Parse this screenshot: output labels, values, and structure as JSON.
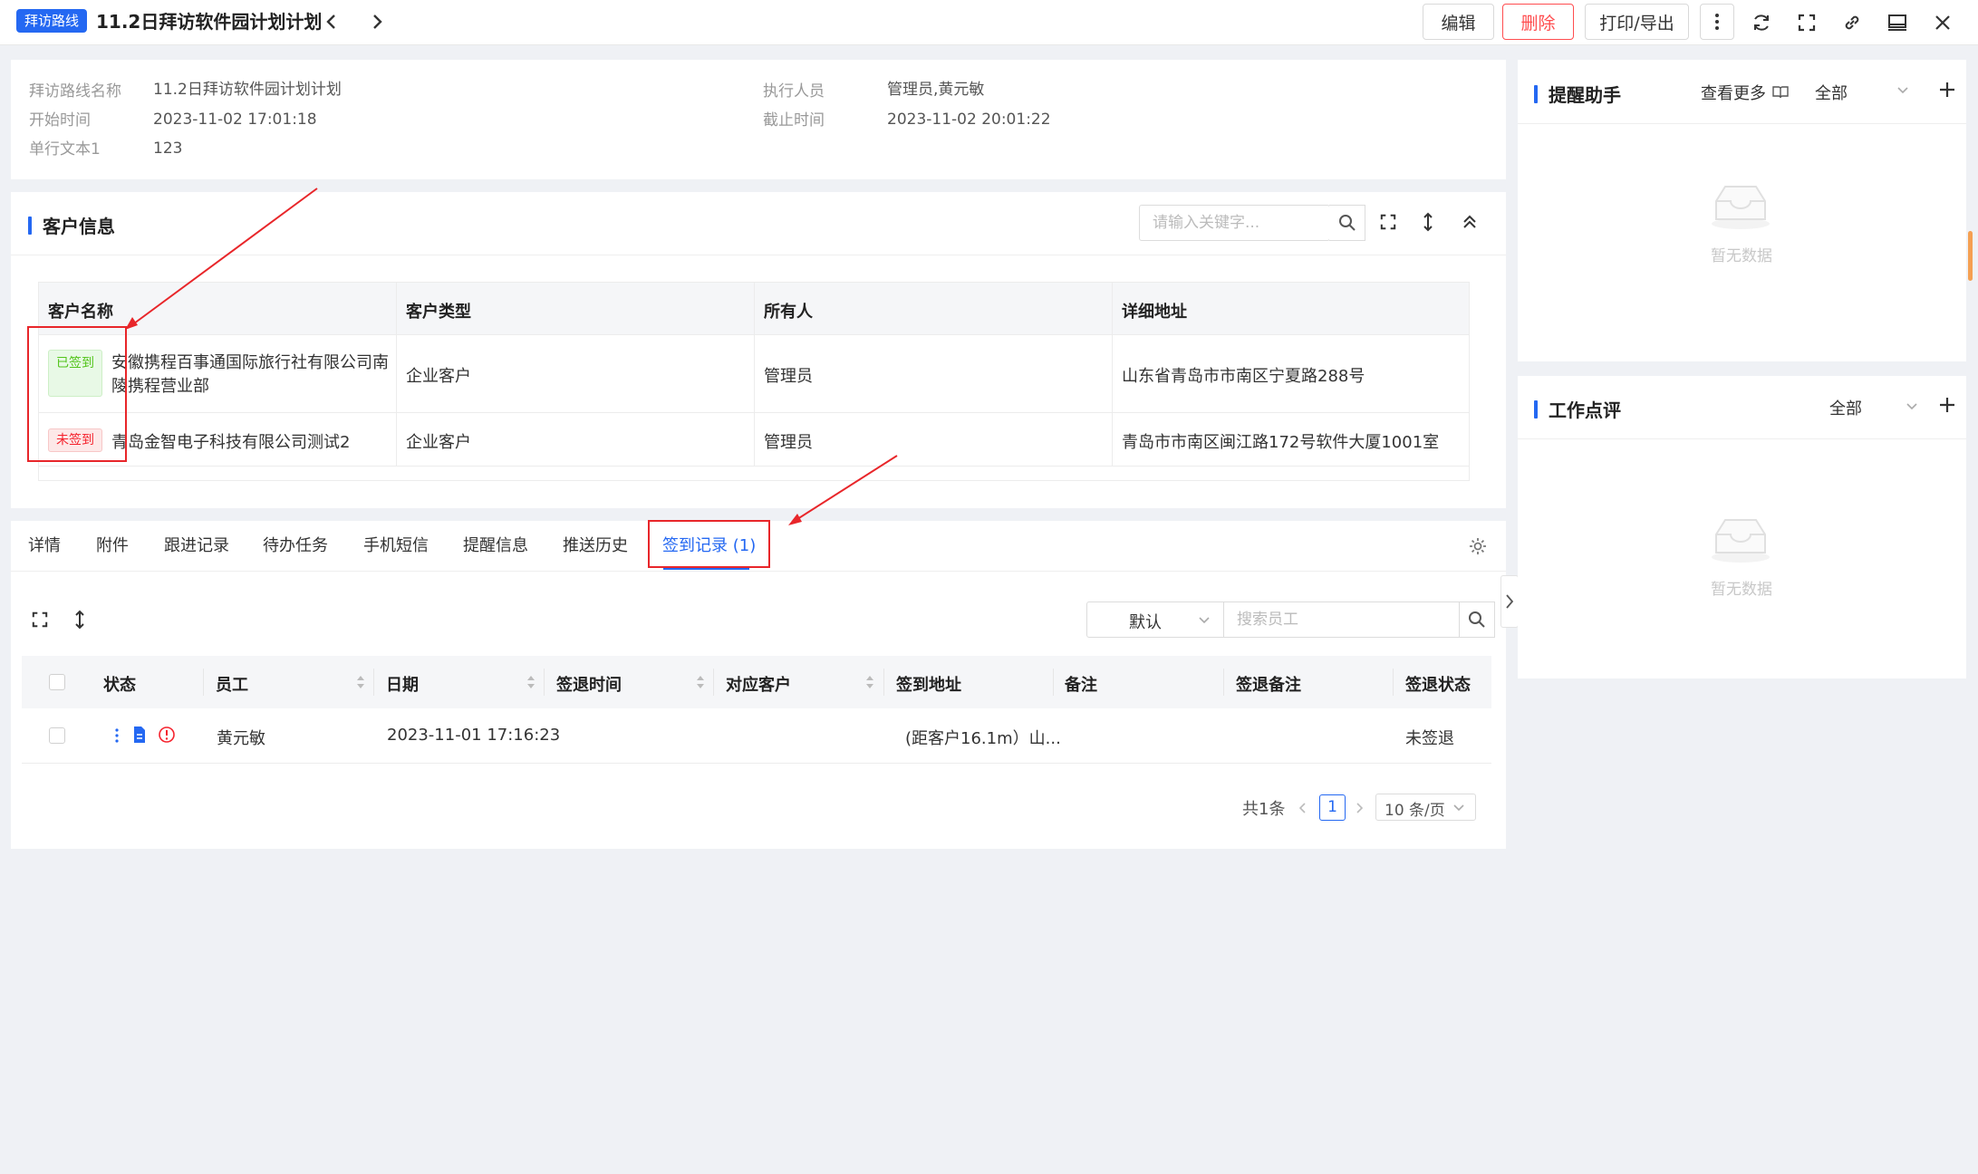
{
  "header": {
    "badge": "拜访路线",
    "title": "11.2日拜访软件园计划计划",
    "buttons": {
      "edit": "编辑",
      "delete": "删除",
      "print": "打印/导出"
    }
  },
  "info": {
    "fields": [
      {
        "label": "拜访路线名称",
        "value": "11.2日拜访软件园计划计划"
      },
      {
        "label": "开始时间",
        "value": "2023-11-02 17:01:18"
      },
      {
        "label": "单行文本1",
        "value": "123"
      },
      {
        "label": "执行人员",
        "value": "管理员,黄元敏"
      },
      {
        "label": "截止时间",
        "value": "2023-11-02 20:01:22"
      }
    ]
  },
  "customer": {
    "title": "客户信息",
    "search_placeholder": "请输入关键字...",
    "columns": [
      "客户名称",
      "客户类型",
      "所有人",
      "详细地址"
    ],
    "rows": [
      {
        "status": "已签到",
        "name_line1": "安徽携程百事通国际旅行社有限公司南",
        "name_line2": "陵携程营业部",
        "type": "企业客户",
        "owner": "管理员",
        "address": "山东省青岛市市南区宁夏路288号"
      },
      {
        "status": "未签到",
        "name_line1": "青岛金智电子科技有限公司测试2",
        "name_line2": "",
        "type": "企业客户",
        "owner": "管理员",
        "address": "青岛市市南区闽江路172号软件大厦1001室"
      }
    ]
  },
  "tabs": [
    "详情",
    "附件",
    "跟进记录",
    "待办任务",
    "手机短信",
    "提醒信息",
    "推送历史",
    "签到记录 (1)"
  ],
  "signin": {
    "filter_select": "默认",
    "search_placeholder": "搜索员工",
    "columns": [
      "状态",
      "员工",
      "日期",
      "签退时间",
      "对应客户",
      "签到地址",
      "备注",
      "签退备注",
      "签退状态"
    ],
    "rows": [
      {
        "employee": "黄元敏",
        "date": "2023-11-01 17:16:23",
        "checkout_time": "",
        "customer": "",
        "address": "(距客户16.1m）山...",
        "remark": "",
        "checkout_remark": "",
        "checkout_status": "未签退"
      }
    ],
    "pagination": {
      "total": "共1条",
      "current": "1",
      "page_size": "10 条/页"
    }
  },
  "reminder": {
    "title": "提醒助手",
    "more": "查看更多",
    "filter": "全部",
    "empty": "暂无数据"
  },
  "review": {
    "title": "工作点评",
    "filter": "全部",
    "empty": "暂无数据"
  },
  "colors": {
    "primary": "#2468f2",
    "danger": "#ff4d4f",
    "success": "#52c41a",
    "annotation": "#e8262a"
  }
}
